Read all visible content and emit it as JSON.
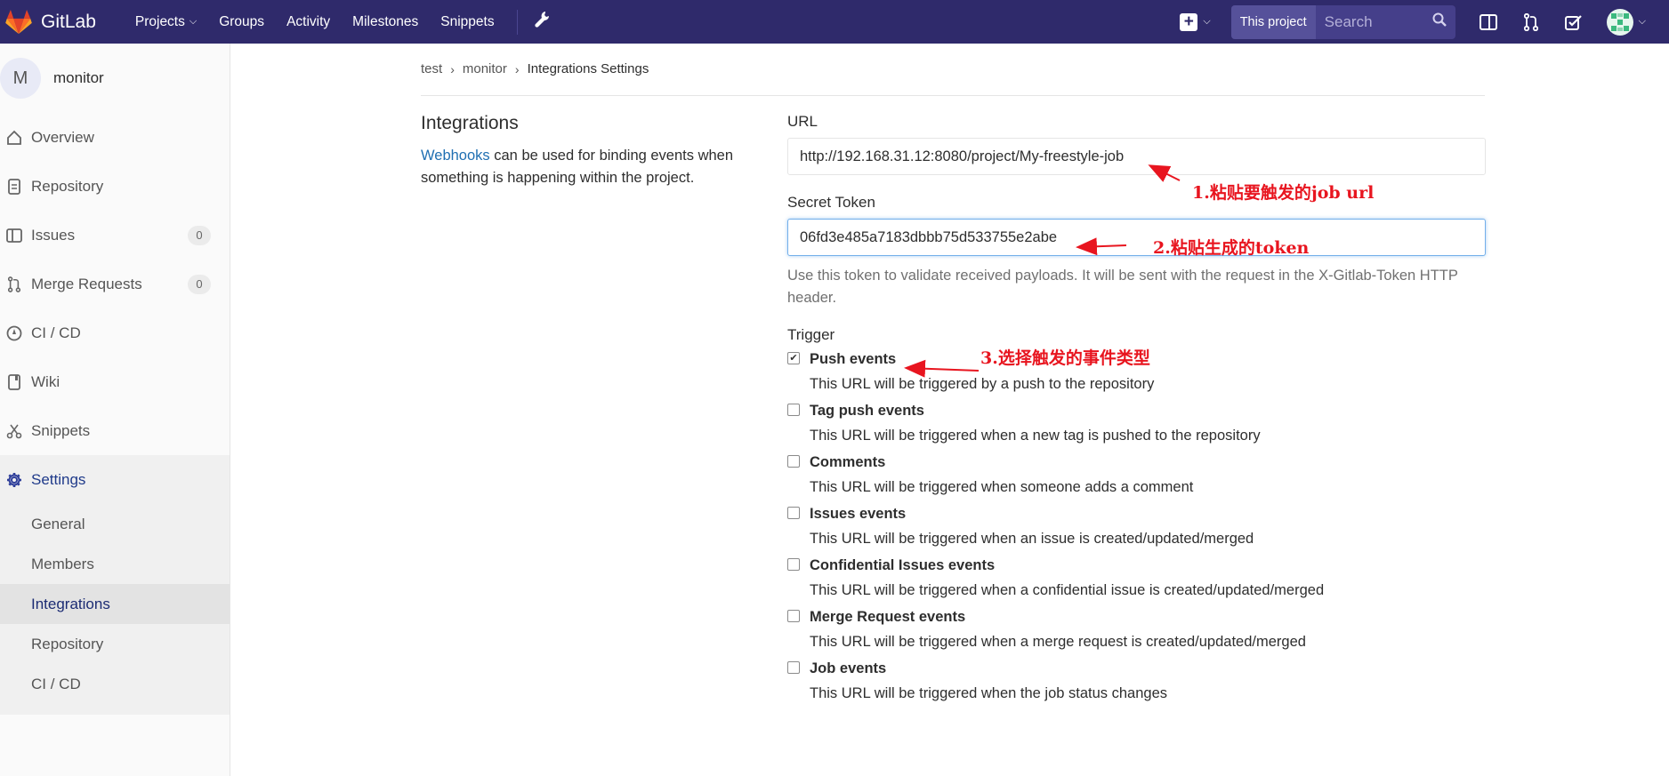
{
  "navbar": {
    "brand": "GitLab",
    "links": [
      {
        "label": "Projects",
        "dropdown": true
      },
      {
        "label": "Groups"
      },
      {
        "label": "Activity"
      },
      {
        "label": "Milestones"
      },
      {
        "label": "Snippets"
      }
    ],
    "search_scope": "This project",
    "search_placeholder": "Search",
    "colors": {
      "navbar_bg": "#2f2a6b",
      "accent": "#e24329"
    }
  },
  "sidebar": {
    "project_initial": "M",
    "project_name": "monitor",
    "items": [
      {
        "label": "Overview",
        "icon": "home-icon"
      },
      {
        "label": "Repository",
        "icon": "document-icon"
      },
      {
        "label": "Issues",
        "icon": "issues-icon",
        "count": "0"
      },
      {
        "label": "Merge Requests",
        "icon": "merge-request-icon",
        "count": "0"
      },
      {
        "label": "CI / CD",
        "icon": "rocket-icon"
      },
      {
        "label": "Wiki",
        "icon": "book-icon"
      },
      {
        "label": "Snippets",
        "icon": "scissors-icon"
      },
      {
        "label": "Settings",
        "icon": "gear-icon"
      }
    ],
    "settings_sub": [
      "General",
      "Members",
      "Integrations",
      "Repository",
      "CI / CD"
    ]
  },
  "breadcrumb": [
    "test",
    "monitor",
    "Integrations Settings"
  ],
  "integrations": {
    "title": "Integrations",
    "desc_link": "Webhooks",
    "desc_rest": " can be used for binding events when something is happening within the project."
  },
  "form": {
    "url_label": "URL",
    "url_value": "http://192.168.31.12:8080/project/My-freestyle-job",
    "token_label": "Secret Token",
    "token_value": "06fd3e485a7183dbbb75d533755e2abe",
    "token_help": "Use this token to validate received payloads. It will be sent with the request in the X-Gitlab-Token HTTP header.",
    "trigger_label": "Trigger",
    "triggers": [
      {
        "title": "Push events",
        "desc": "This URL will be triggered by a push to the repository",
        "checked": true
      },
      {
        "title": "Tag push events",
        "desc": "This URL will be triggered when a new tag is pushed to the repository",
        "checked": false
      },
      {
        "title": "Comments",
        "desc": "This URL will be triggered when someone adds a comment",
        "checked": false
      },
      {
        "title": "Issues events",
        "desc": "This URL will be triggered when an issue is created/updated/merged",
        "checked": false
      },
      {
        "title": "Confidential Issues events",
        "desc": "This URL will be triggered when a confidential issue is created/updated/merged",
        "checked": false
      },
      {
        "title": "Merge Request events",
        "desc": "This URL will be triggered when a merge request is created/updated/merged",
        "checked": false
      },
      {
        "title": "Job events",
        "desc": "This URL will be triggered when the job status changes",
        "checked": false
      }
    ]
  },
  "annotations": {
    "a1": "1.粘贴要触发的job url",
    "a2": "2.粘贴生成的token",
    "a3": "3.选择触发的事件类型",
    "color": "#e8151f"
  }
}
